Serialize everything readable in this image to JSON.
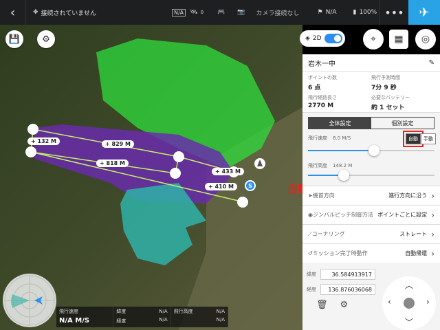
{
  "topbar": {
    "back_icon": "chevron-left-icon",
    "status": "接続されていません",
    "gps_badge": "N/A",
    "signal_count": "0",
    "camera_status": "カメラ接続なし",
    "gps_value": "N/A",
    "battery": "100%"
  },
  "map": {
    "distances": [
      "132 M",
      "829 M",
      "818 M",
      "433 M",
      "410 M"
    ],
    "annotation": "自動で飛んで行く",
    "toggle_label": "2D"
  },
  "panel": {
    "mission_name": "岩木一中",
    "stats": [
      {
        "label": "ポイントの数",
        "value": "6 点"
      },
      {
        "label": "飛行予測時間",
        "value": "7分 9 秒"
      },
      {
        "label": "飛行経路長さ",
        "value": "2770 M"
      },
      {
        "label": "必要なバッテリー",
        "value": "約 1 セット"
      }
    ],
    "tabs": [
      "全体設定",
      "個別設定"
    ],
    "speed_label": "飛行速度",
    "speed_value": "8.0 M/S",
    "speed_fraction": 0.52,
    "mode_auto": "自動",
    "mode_manual": "手動",
    "altitude_label": "飛行高度",
    "altitude_value": "148.2 M",
    "altitude_fraction": 0.28,
    "settings": [
      {
        "label": "機首方向",
        "value": "進行方向に沿う"
      },
      {
        "label": "ジンバルピッチ制御方法",
        "value": "ポイントごとに設定"
      },
      {
        "label": "コーナリング",
        "value": "ストレート"
      },
      {
        "label": "ミッション完了時動作",
        "value": "自動帰還"
      }
    ],
    "latitude_label": "緯度",
    "latitude": "36.584913917",
    "longitude_label": "経度",
    "longitude": "136.876036068"
  },
  "telemetry": {
    "speed_label": "飛行速度",
    "speed_value": "N/A M/S",
    "lat_label": "緯度",
    "lat_value": "N/A",
    "lon_label": "経度",
    "lon_value": "N/A",
    "alt_label": "飛行高度",
    "alt_value": "N/A",
    "alt2_value": "N/A"
  }
}
